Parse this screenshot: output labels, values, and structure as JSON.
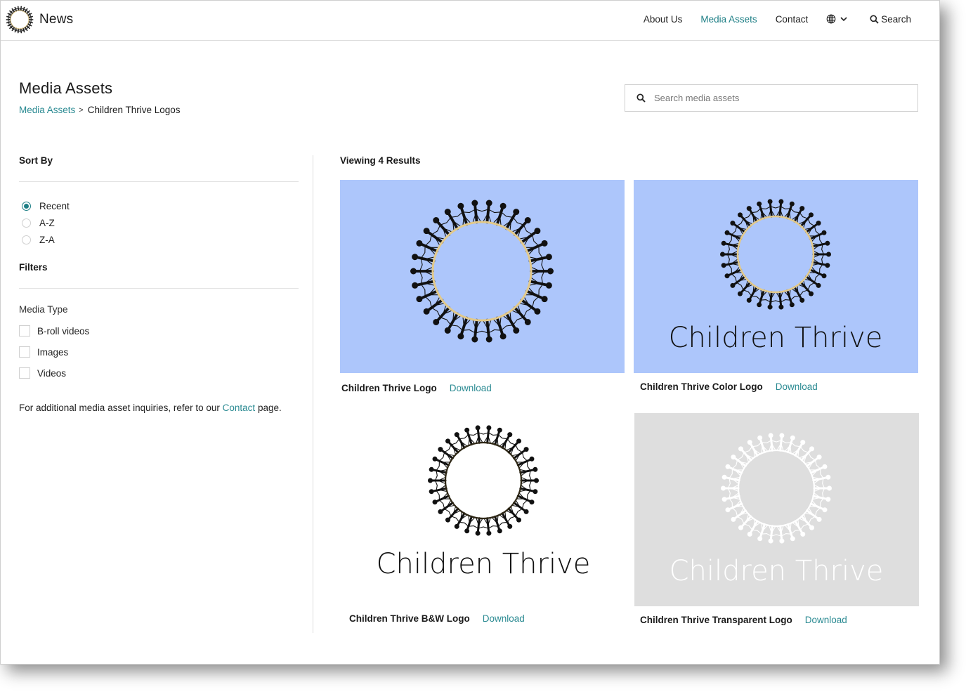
{
  "header": {
    "brand": "News",
    "nav": [
      {
        "label": "About Us",
        "active": false
      },
      {
        "label": "Media Assets",
        "active": true
      },
      {
        "label": "Contact",
        "active": false
      }
    ],
    "language_icon": "globe-icon",
    "search_label": "Search"
  },
  "page": {
    "title": "Media Assets",
    "breadcrumb": {
      "parent": "Media Assets",
      "separator": ">",
      "current": "Children Thrive Logos"
    },
    "search": {
      "placeholder": "Search media assets",
      "value": ""
    }
  },
  "sidebar": {
    "sort_heading": "Sort By",
    "sort_options": [
      {
        "label": "Recent",
        "checked": true
      },
      {
        "label": "A-Z",
        "checked": false
      },
      {
        "label": "Z-A",
        "checked": false
      }
    ],
    "filters_heading": "Filters",
    "media_type_label": "Media Type",
    "media_types": [
      {
        "label": "B-roll videos",
        "checked": false
      },
      {
        "label": "Images",
        "checked": false
      },
      {
        "label": "Videos",
        "checked": false
      }
    ],
    "note": {
      "before": "For additional media asset inquiries, refer to our ",
      "link": "Contact",
      "after": " page."
    }
  },
  "results": {
    "count_label": "Viewing 4 Results",
    "download_label": "Download",
    "items": [
      {
        "title": "Children Thrive Logo",
        "logo_text": "",
        "bg": "#adc6fb",
        "figure_color": "#111111",
        "ring_color": "#e2c98a"
      },
      {
        "title": "Children Thrive Color Logo",
        "logo_text": "Children Thrive",
        "bg": "#adc6fb",
        "figure_color": "#111111",
        "ring_color": "#e2c98a"
      },
      {
        "title": "Children Thrive B&W Logo",
        "logo_text": "Children Thrive",
        "bg": "#ffffff",
        "figure_color": "#111111",
        "ring_color": "#2d2614"
      },
      {
        "title": "Children Thrive Transparent Logo",
        "logo_text": "Children Thrive",
        "bg": "#dedede",
        "figure_color": "#ffffff",
        "ring_color": "#ffffff"
      }
    ]
  },
  "colors": {
    "accent": "#1e7f86",
    "link": "#2a8a92"
  }
}
